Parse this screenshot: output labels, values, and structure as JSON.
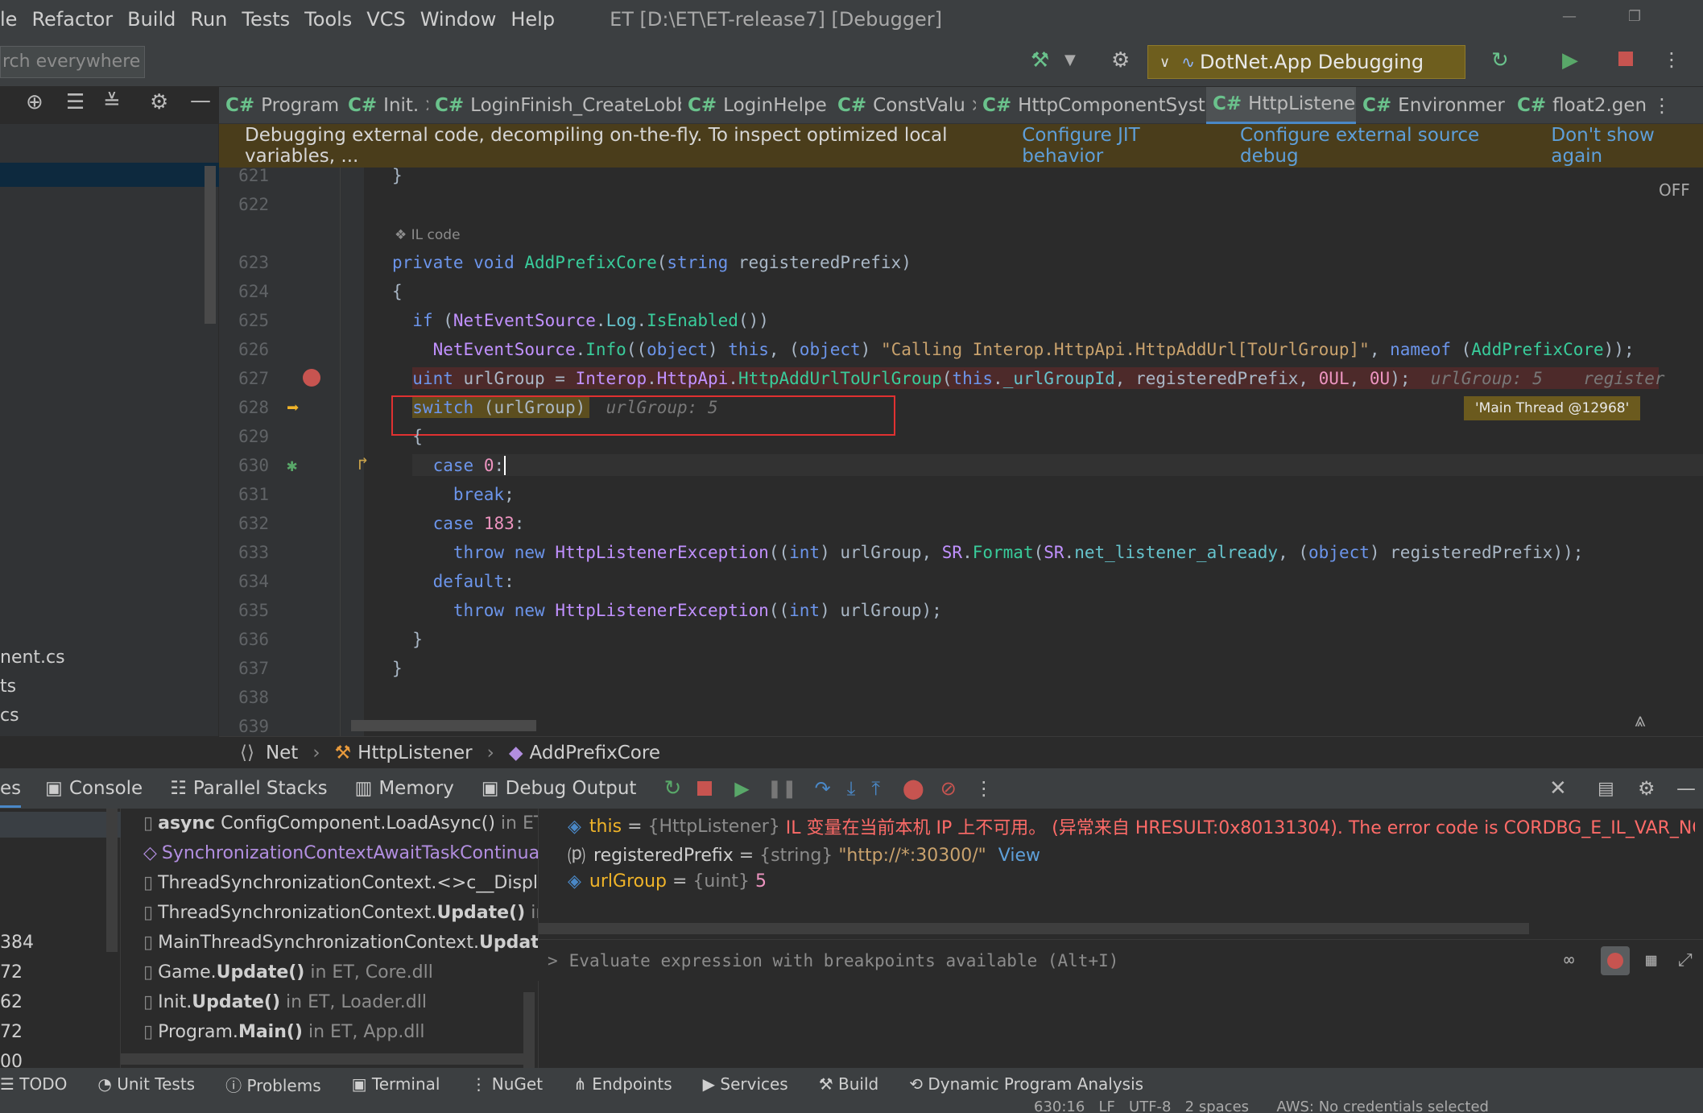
{
  "menu": {
    "items": [
      "le",
      "Refactor",
      "Build",
      "Run",
      "Tests",
      "Tools",
      "VCS",
      "Window",
      "Help"
    ],
    "title": "ET [D:\\ET\\ET-release7] [Debugger]"
  },
  "toolbar": {
    "search_placeholder": "rch everywhere",
    "run_config": "DotNet.App Debugging"
  },
  "tabs": [
    {
      "label": "Program",
      "active": false
    },
    {
      "label": "Init.",
      "active": false
    },
    {
      "label": "LoginFinish_CreateLobb",
      "active": false
    },
    {
      "label": "LoginHelpe",
      "active": false
    },
    {
      "label": "ConstValu",
      "active": false
    },
    {
      "label": "HttpComponentSyst",
      "active": false
    },
    {
      "label": "HttpListene",
      "active": true
    },
    {
      "label": "Environmer",
      "active": false
    },
    {
      "label": "float2.gen.",
      "active": false
    }
  ],
  "banner": {
    "message": "Debugging external code, decompiling on-the-fly. To inspect optimized local variables, ...",
    "link1": "Configure JIT behavior",
    "link2": "Configure external source debug",
    "link3": "Don't show again"
  },
  "editor": {
    "off_label": "OFF",
    "il_code": "IL code",
    "lines": [
      "621",
      "622",
      "623",
      "624",
      "625",
      "626",
      "627",
      "628",
      "629",
      "630",
      "631",
      "632",
      "633",
      "634",
      "635",
      "636",
      "637",
      "638",
      "639"
    ],
    "inline_hint_627": "urlGroup: 5    register",
    "inline_hint_628": "urlGroup: 5",
    "thread_label": "'Main Thread @12968'"
  },
  "left_panel": {
    "files": [
      "nent.cs",
      "ts",
      "cs"
    ]
  },
  "breadcrumb": {
    "items": [
      "Net",
      "HttpListener",
      "AddPrefixCore"
    ]
  },
  "debug_tabs": [
    "es",
    "Console",
    "Parallel Stacks",
    "Memory",
    "Debug Output"
  ],
  "frames": [
    {
      "bold": "async",
      "name": "ConfigComponent.LoadAsync()",
      "loc": "in ET"
    },
    {
      "bold": "",
      "name": "SynchronizationContextAwaitTaskContinuat",
      "loc": ""
    },
    {
      "bold": "",
      "name": "ThreadSynchronizationContext.<>c__Display",
      "loc": ""
    },
    {
      "bold": "Update()",
      "name": "ThreadSynchronizationContext.",
      "loc": "in I"
    },
    {
      "bold": "Update",
      "name": "MainThreadSynchronizationContext.",
      "loc": ""
    },
    {
      "bold": "Update()",
      "name": "Game.",
      "loc": "in ET, Core.dll"
    },
    {
      "bold": "Update()",
      "name": "Init.",
      "loc": "in ET, Loader.dll"
    },
    {
      "bold": "Main()",
      "name": "Program.",
      "loc": "in ET, App.dll"
    }
  ],
  "frame_numbers": [
    "384",
    "72",
    "62",
    "72",
    "00"
  ],
  "variables": [
    {
      "name": "this",
      "type": "{HttpListener}",
      "value": "IL 变量在当前本机 IP 上不可用。 (异常来自 HRESULT:0x80131304). The error code is CORDBG_E_IL_VAR_NOT_AV"
    },
    {
      "name": "registeredPrefix",
      "type": "{string}",
      "value": "\"http://*:30300/\"",
      "extra": "View"
    },
    {
      "name": "urlGroup",
      "type": "{uint}",
      "value": "5"
    }
  ],
  "eval": {
    "placeholder": "Evaluate expression with breakpoints available (Alt+I)"
  },
  "bottom_tools": [
    "TODO",
    "Unit Tests",
    "Problems",
    "Terminal",
    "NuGet",
    "Endpoints",
    "Services",
    "Build",
    "Dynamic Program Analysis"
  ],
  "status": {
    "text": "630:16   LF   UTF-8   2 spaces      AWS: No credentials selected"
  },
  "colors": {
    "accent": "#4a88c7",
    "breakpoint": "#c75450",
    "error_text": "#ff6b68"
  }
}
